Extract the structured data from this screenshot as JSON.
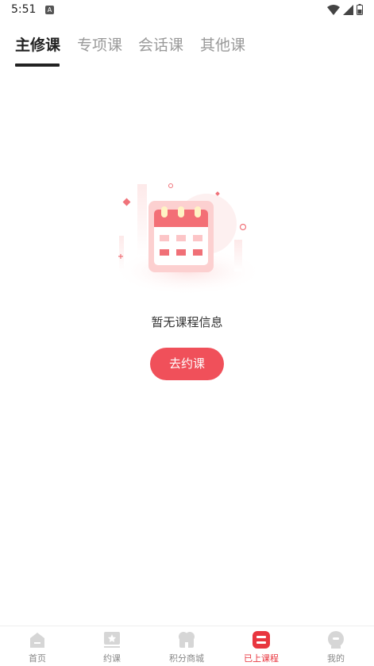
{
  "status_bar": {
    "time": "5:51",
    "notification_icon_letter": "A",
    "icons": [
      "wifi-icon",
      "signal-icon",
      "battery-icon"
    ]
  },
  "tabs": [
    {
      "label": "主修课",
      "active": true
    },
    {
      "label": "专项课",
      "active": false
    },
    {
      "label": "会话课",
      "active": false
    },
    {
      "label": "其他课",
      "active": false
    }
  ],
  "empty_state": {
    "illustration": "calendar-icon",
    "message": "暂无课程信息",
    "button_label": "去约课"
  },
  "bottom_nav": [
    {
      "label": "首页",
      "icon": "home-icon",
      "active": false
    },
    {
      "label": "约课",
      "icon": "book-lesson-icon",
      "active": false
    },
    {
      "label": "积分商城",
      "icon": "shop-icon",
      "active": false
    },
    {
      "label": "已上课程",
      "icon": "courses-taken-icon",
      "active": true
    },
    {
      "label": "我的",
      "icon": "profile-icon",
      "active": false
    }
  ],
  "colors": {
    "accent": "#f0505a",
    "active_nav": "#e8363f",
    "inactive_text": "#999999",
    "nav_icon_inactive": "#d6d6d6"
  }
}
